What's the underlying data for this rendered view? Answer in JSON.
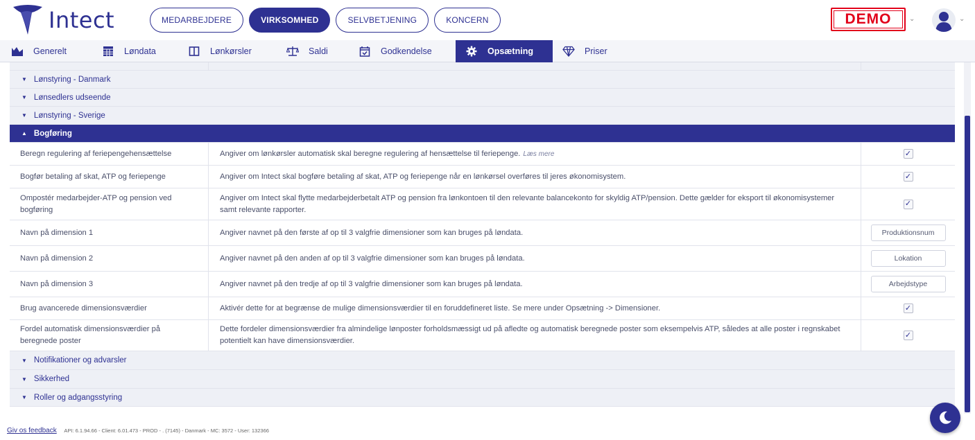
{
  "app": {
    "logo_text": "Intect",
    "brand_color": "#2e3192",
    "demo_badge": "DEMO"
  },
  "top_nav": [
    {
      "label": "MEDARBEJDERE",
      "active": false
    },
    {
      "label": "VIRKSOMHED",
      "active": true
    },
    {
      "label": "SELVBETJENING",
      "active": false
    },
    {
      "label": "KONCERN",
      "active": false
    }
  ],
  "tabs": [
    {
      "label": "Generelt",
      "icon": "chart-icon",
      "active": false
    },
    {
      "label": "Løndata",
      "icon": "table-icon",
      "active": false
    },
    {
      "label": "Lønkørsler",
      "icon": "book-icon",
      "active": false
    },
    {
      "label": "Saldi",
      "icon": "scale-icon",
      "active": false
    },
    {
      "label": "Godkendelse",
      "icon": "calendar-check-icon",
      "active": false
    },
    {
      "label": "Opsætning",
      "icon": "gear-icon",
      "active": true
    },
    {
      "label": "Priser",
      "icon": "diamond-icon",
      "active": false
    }
  ],
  "sections_before": [
    {
      "label": "Lønstyring - Danmark",
      "expanded": false
    },
    {
      "label": "Lønsedlers udseende",
      "expanded": false
    },
    {
      "label": "Lønstyring - Sverige",
      "expanded": false
    }
  ],
  "open_section": {
    "label": "Bogføring",
    "expanded": true
  },
  "settings": [
    {
      "name": "Beregn regulering af feriepengehensættelse",
      "description": "Angiver om lønkørsler automatisk skal beregne regulering af hensættelse til feriepenge.",
      "link": "Læs mere",
      "value_type": "checkbox",
      "checked": true
    },
    {
      "name": "Bogfør betaling af skat, ATP og feriepenge",
      "description": "Angiver om Intect skal bogføre betaling af skat, ATP og feriepenge når en lønkørsel overføres til jeres økonomisystem.",
      "value_type": "checkbox",
      "checked": true
    },
    {
      "name": "Ompostér medarbejder-ATP og pension ved bogføring",
      "description": "Angiver om Intect skal flytte medarbejderbetalt ATP og pension fra lønkontoen til den relevante balancekonto for skyldig ATP/pension. Dette gælder for eksport til økonomisystemer samt relevante rapporter.",
      "value_type": "checkbox",
      "checked": true
    },
    {
      "name": "Navn på dimension 1",
      "description": "Angiver navnet på den første af op til 3 valgfrie dimensioner som kan bruges på løndata.",
      "value_type": "text",
      "value": "Produktionsnum"
    },
    {
      "name": "Navn på dimension 2",
      "description": "Angiver navnet på den anden af op til 3 valgfrie dimensioner som kan bruges på løndata.",
      "value_type": "text",
      "value": "Lokation"
    },
    {
      "name": "Navn på dimension 3",
      "description": "Angiver navnet på den tredje af op til 3 valgfrie dimensioner som kan bruges på løndata.",
      "value_type": "text",
      "value": "Arbejdstype"
    },
    {
      "name": "Brug avancerede dimensionsværdier",
      "description": "Aktivér dette for at begrænse de mulige dimensionsværdier til en foruddefineret liste. Se mere under Opsætning -> Dimensioner.",
      "value_type": "checkbox",
      "checked": true
    },
    {
      "name": "Fordel automatisk dimensionsværdier på beregnede poster",
      "description": "Dette fordeler dimensionsværdier fra almindelige lønposter forholdsmæssigt ud på afledte og automatisk beregnede poster som eksempelvis ATP, således at alle poster i regnskabet potentielt kan have dimensionsværdier.",
      "value_type": "checkbox",
      "checked": true
    }
  ],
  "sections_after": [
    {
      "label": "Notifikationer og advarsler",
      "expanded": false
    },
    {
      "label": "Sikkerhed",
      "expanded": false
    },
    {
      "label": "Roller og adgangsstyring",
      "expanded": false
    }
  ],
  "footer": {
    "feedback_link": "Giv os feedback",
    "meta": "API: 6.1.94.66 - Client: 6.01.473 - PROD - . (7145) - Danmark - MC: 3572 - User: 132366"
  }
}
